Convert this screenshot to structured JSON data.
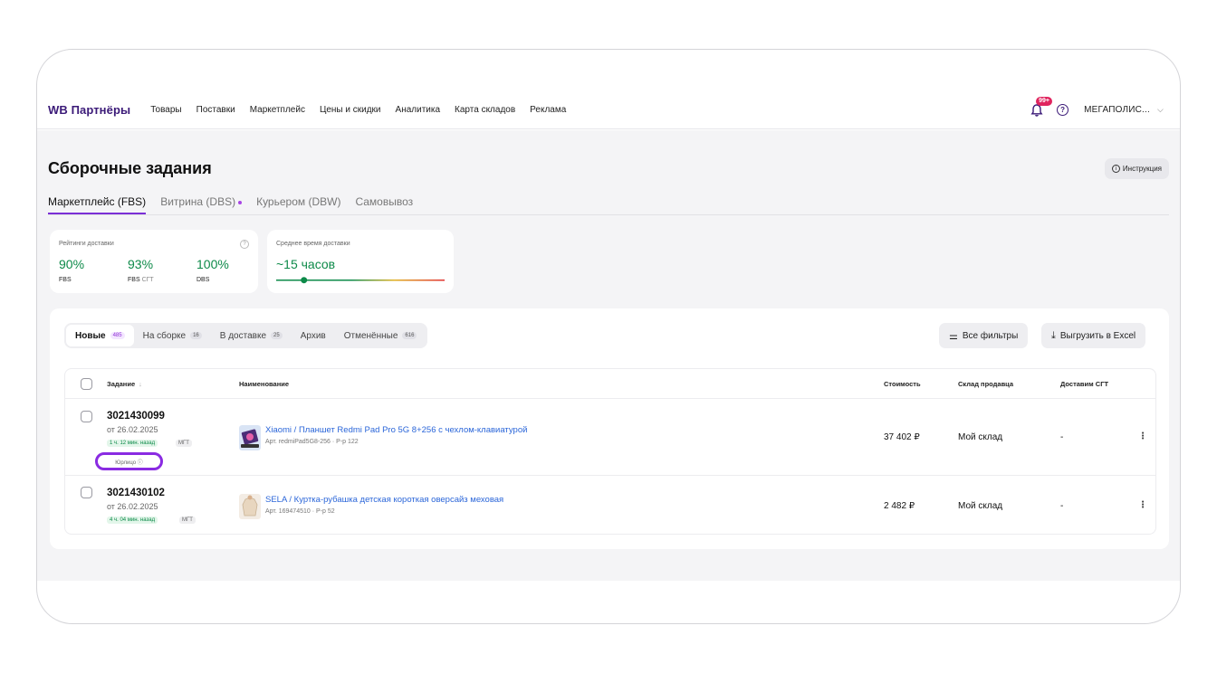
{
  "nav": {
    "brand": "WB Партнёры",
    "items": [
      "Товары",
      "Поставки",
      "Маркетплейс",
      "Цены и скидки",
      "Аналитика",
      "Карта складов",
      "Реклама"
    ],
    "notif_badge": "99+",
    "help": "?",
    "account": "МЕГАПОЛИС...",
    "account_chev": "⌵"
  },
  "page": {
    "title": "Сборочные задания",
    "instruction": "Инструкция",
    "tabs": [
      "Маркетплейс (FBS)",
      "Витрина (DBS)",
      "Курьером (DBW)",
      "Самовывоз"
    ]
  },
  "ratings": {
    "label": "Рейтинги доставки",
    "items": [
      {
        "value": "90%",
        "caption": "FBS",
        "muted": ""
      },
      {
        "value": "93%",
        "caption": "FBS",
        "muted": "СГТ"
      },
      {
        "value": "100%",
        "caption": "DBS",
        "muted": ""
      }
    ],
    "accent": "#0d8a49"
  },
  "delivery_time": {
    "label": "Среднее время доставки",
    "value": "~15 часов",
    "level": 0.15
  },
  "orders": {
    "subtabs": [
      {
        "label": "Новые",
        "count": "485"
      },
      {
        "label": "На сборке",
        "count": "16"
      },
      {
        "label": "В доставке",
        "count": "25"
      },
      {
        "label": "Архив",
        "count": ""
      },
      {
        "label": "Отменённые",
        "count": "616"
      }
    ],
    "filters_btn": "Все фильтры",
    "export_btn": "Выгрузить в Excel",
    "columns": {
      "task": "Задание",
      "name": "Наименование",
      "cost": "Стоимость",
      "warehouse": "Склад продавца",
      "sgt": "Доставим СГТ"
    },
    "rows": [
      {
        "id": "3021430099",
        "date": "от 26.02.2025",
        "ago": "1 ч. 12 мин. назад",
        "tag": "МГТ",
        "legal": "Юрлицо ⓘ",
        "product": "Xiaomi / Планшет Redmi Pad Pro 5G 8+256 с чехлом-клавиатурой",
        "art": "Арт. redmiPad5G8-256 · Р-р 122",
        "cost": "37 402 ₽",
        "warehouse": "Мой склад",
        "sgt": "-"
      },
      {
        "id": "3021430102",
        "date": "от 26.02.2025",
        "ago": "4 ч. 04 мин. назад",
        "tag": "МГТ",
        "product": "SELA / Куртка-рубашка детская короткая оверсайз меховая",
        "art": "Арт. 169474510 · Р-р 52",
        "cost": "2 482 ₽",
        "warehouse": "Мой склад",
        "sgt": "-"
      }
    ],
    "kebab": "⋮"
  }
}
